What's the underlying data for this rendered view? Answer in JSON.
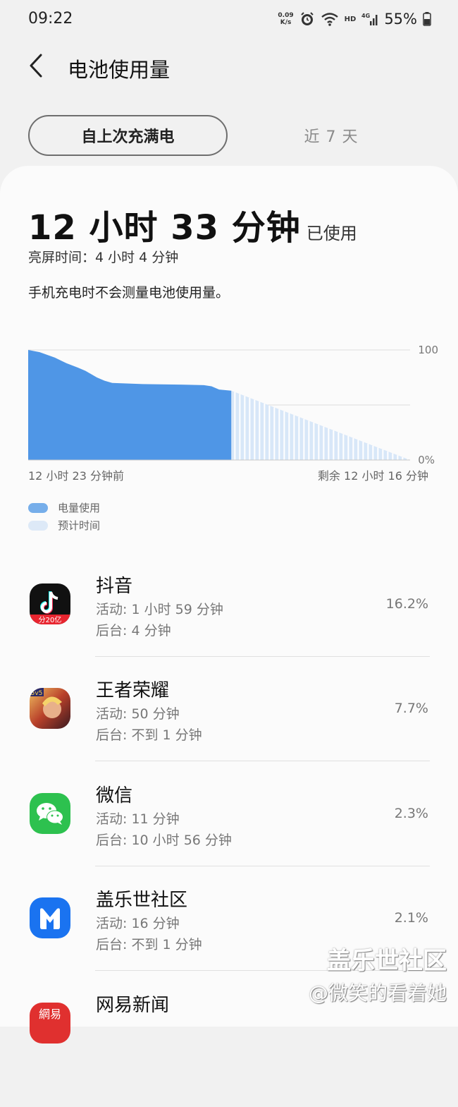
{
  "status_bar": {
    "time": "09:22",
    "net_speed_value": "0.09",
    "net_speed_unit": "K/s",
    "hd_label": "HD",
    "network_label": "4G",
    "battery_percent": "55%"
  },
  "header": {
    "title": "电池使用量"
  },
  "tabs": {
    "active": "自上次充满电",
    "inactive": "近 7 天"
  },
  "summary": {
    "usage_time": "12 小时 33 分钟",
    "usage_suffix": "已使用",
    "screen_time": "亮屏时间：4 小时 4 分钟",
    "note": "手机充电时不会测量电池使用量。"
  },
  "chart_data": {
    "type": "area",
    "y_tick_labels": [
      "100",
      "0%"
    ],
    "ylim": [
      0,
      100
    ],
    "x_start_label": "12 小时 23 分钟前",
    "x_end_label": "剩余 12 小时 16 分钟",
    "series": [
      {
        "name": "电量使用",
        "color": "#4f96e6",
        "points": [
          [
            0,
            100
          ],
          [
            0.03,
            98
          ],
          [
            0.07,
            93
          ],
          [
            0.1,
            88
          ],
          [
            0.13,
            84
          ],
          [
            0.15,
            81
          ],
          [
            0.18,
            75
          ],
          [
            0.2,
            72
          ],
          [
            0.22,
            70
          ],
          [
            0.3,
            69
          ],
          [
            0.4,
            68.5
          ],
          [
            0.46,
            68
          ],
          [
            0.48,
            67
          ],
          [
            0.5,
            64
          ],
          [
            0.532,
            63
          ]
        ]
      },
      {
        "name": "预计时间",
        "color": "#d8e7f8",
        "points": [
          [
            0.532,
            63
          ],
          [
            1,
            0
          ]
        ]
      }
    ],
    "grid": true
  },
  "legend": {
    "usage": "电量使用",
    "estimate": "预计时间"
  },
  "apps": [
    {
      "name": "抖音",
      "foreground": "活动: 1 小时 59 分钟",
      "background": "后台: 4 分钟",
      "percent": "16.2%",
      "icon_text": "分20亿"
    },
    {
      "name": "王者荣耀",
      "foreground": "活动: 50 分钟",
      "background": "后台: 不到 1 分钟",
      "percent": "7.7%",
      "icon_text": "5v5"
    },
    {
      "name": "微信",
      "foreground": "活动: 11 分钟",
      "background": "后台: 10 小时 56 分钟",
      "percent": "2.3%"
    },
    {
      "name": "盖乐世社区",
      "foreground": "活动: 16 分钟",
      "background": "后台: 不到 1 分钟",
      "percent": "2.1%"
    },
    {
      "name": "网易新闻",
      "icon_text": "網易"
    }
  ],
  "watermark": {
    "line1": "盖乐世社区",
    "line2": "@微笑的看着她"
  }
}
